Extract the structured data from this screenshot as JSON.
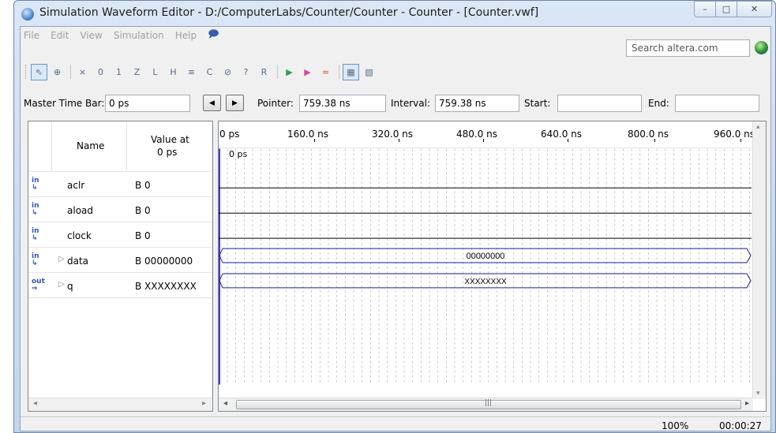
{
  "window": {
    "title": "Simulation Waveform Editor - D:/ComputerLabs/Counter/Counter - Counter - [Counter.vwf]",
    "buttons": [
      "minimize-icon",
      "maximize-icon",
      "close-icon"
    ]
  },
  "menu": {
    "items": [
      "File",
      "Edit",
      "View",
      "Simulation",
      "Help"
    ],
    "feedback_icon": "feedback-icon"
  },
  "search": {
    "placeholder": "Search altera.com"
  },
  "toolbar": {
    "icons": [
      "select-pointer-icon",
      "zoom-icon",
      "force-unknown-icon",
      "force-low-icon",
      "force-high-icon",
      "force-high-impedance-icon",
      "force-weak-low-icon",
      "force-weak-high-icon",
      "invert-icon",
      "count-value-icon",
      "force-dont-care-icon",
      "random-values-icon",
      "overwrite-clock-icon",
      "functional-simulation-icon",
      "timing-simulation-icon",
      "netlist-viewer-icon",
      "snap-to-grid-icon",
      "grid-icon"
    ]
  },
  "timebar": {
    "master_label": "Master Time Bar:",
    "master_value": "0 ps",
    "pointer_label": "Pointer:",
    "pointer_value": "759.38 ns",
    "interval_label": "Interval:",
    "interval_value": "759.38 ns",
    "start_label": "Start:",
    "start_value": "",
    "end_label": "End:",
    "end_value": ""
  },
  "table": {
    "name_header": "Name",
    "value_header_line1": "Value at",
    "value_header_line2": "0 ps",
    "rows": [
      {
        "icon": "in",
        "name": "aclr",
        "value": "B 0",
        "expandable": false
      },
      {
        "icon": "in",
        "name": "aload",
        "value": "B 0",
        "expandable": false
      },
      {
        "icon": "in",
        "name": "clock",
        "value": "B 0",
        "expandable": false
      },
      {
        "icon": "in",
        "name": "data",
        "value": "B 00000000",
        "expandable": true
      },
      {
        "icon": "out",
        "name": "q",
        "value": "B XXXXXXXX",
        "expandable": true
      }
    ]
  },
  "timeline": {
    "labels": [
      "0 ps",
      "160.0 ns",
      "320.0 ns",
      "480.0 ns",
      "640.0 ns",
      "800.0 ns",
      "960.0 ns"
    ],
    "marker": "0 ps"
  },
  "waves": {
    "data_bus_label": "00000000",
    "q_bus_label": "XXXXXXXX"
  },
  "status": {
    "zoom": "100%",
    "time": "00:00:27"
  }
}
